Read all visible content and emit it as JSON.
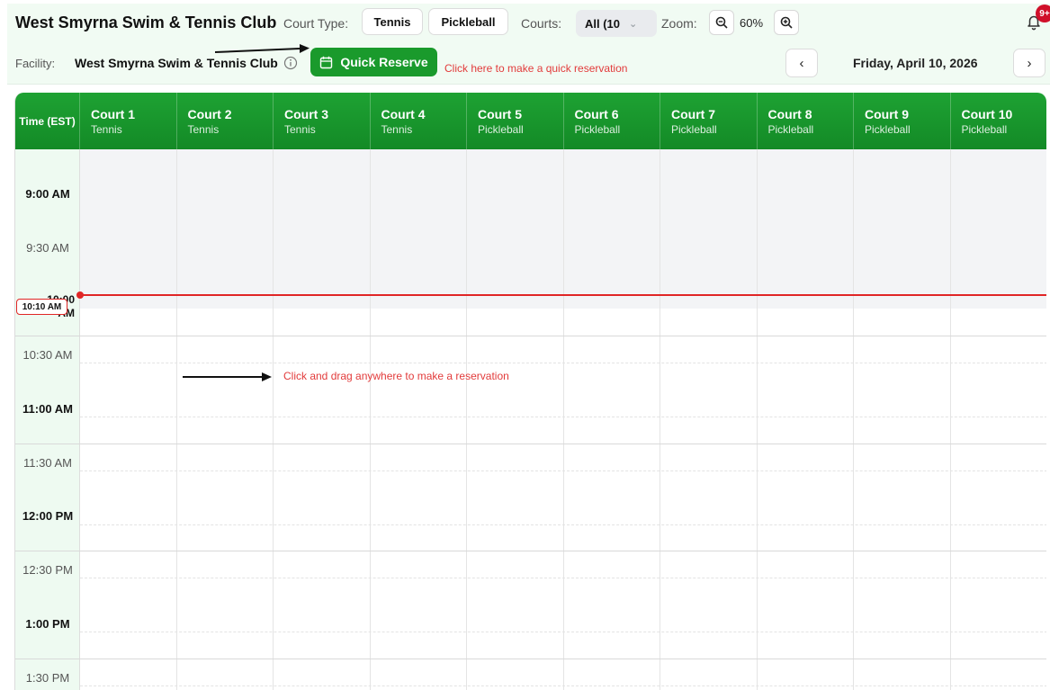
{
  "header": {
    "title": "West Smyrna Swim & Tennis Club",
    "court_type_label": "Court Type:",
    "court_types": [
      "Tennis",
      "Pickleball"
    ],
    "courts_label": "Courts:",
    "courts_value": "All (10",
    "zoom_label": "Zoom:",
    "zoom_value": "60%",
    "notification_badge": "9+"
  },
  "subbar": {
    "facility_label": "Facility:",
    "facility_name": "West Smyrna Swim & Tennis Club",
    "quick_reserve_label": "Quick Reserve",
    "quick_reserve_hint": "Click here to make a quick reservation",
    "date": "Friday, April 10, 2026"
  },
  "grid": {
    "time_header": "Time (EST)",
    "courts": [
      {
        "name": "Court 1",
        "type": "Tennis"
      },
      {
        "name": "Court 2",
        "type": "Tennis"
      },
      {
        "name": "Court 3",
        "type": "Tennis"
      },
      {
        "name": "Court 4",
        "type": "Tennis"
      },
      {
        "name": "Court 5",
        "type": "Pickleball"
      },
      {
        "name": "Court 6",
        "type": "Pickleball"
      },
      {
        "name": "Court 7",
        "type": "Pickleball"
      },
      {
        "name": "Court 8",
        "type": "Pickleball"
      },
      {
        "name": "Court 9",
        "type": "Pickleball"
      },
      {
        "name": "Court 10",
        "type": "Pickleball"
      }
    ],
    "times": [
      "9:00 AM",
      "9:30 AM",
      "10:00 AM",
      "10:30 AM",
      "11:00 AM",
      "11:30 AM",
      "12:00 PM",
      "12:30 PM",
      "1:00 PM",
      "1:30 PM"
    ],
    "current_time": "10:10 AM",
    "drag_hint": "Click and drag anywhere to make a reservation"
  },
  "colors": {
    "brand_green": "#1a9a2c",
    "now_line": "#e02626",
    "hint_red": "#e23b3b"
  }
}
